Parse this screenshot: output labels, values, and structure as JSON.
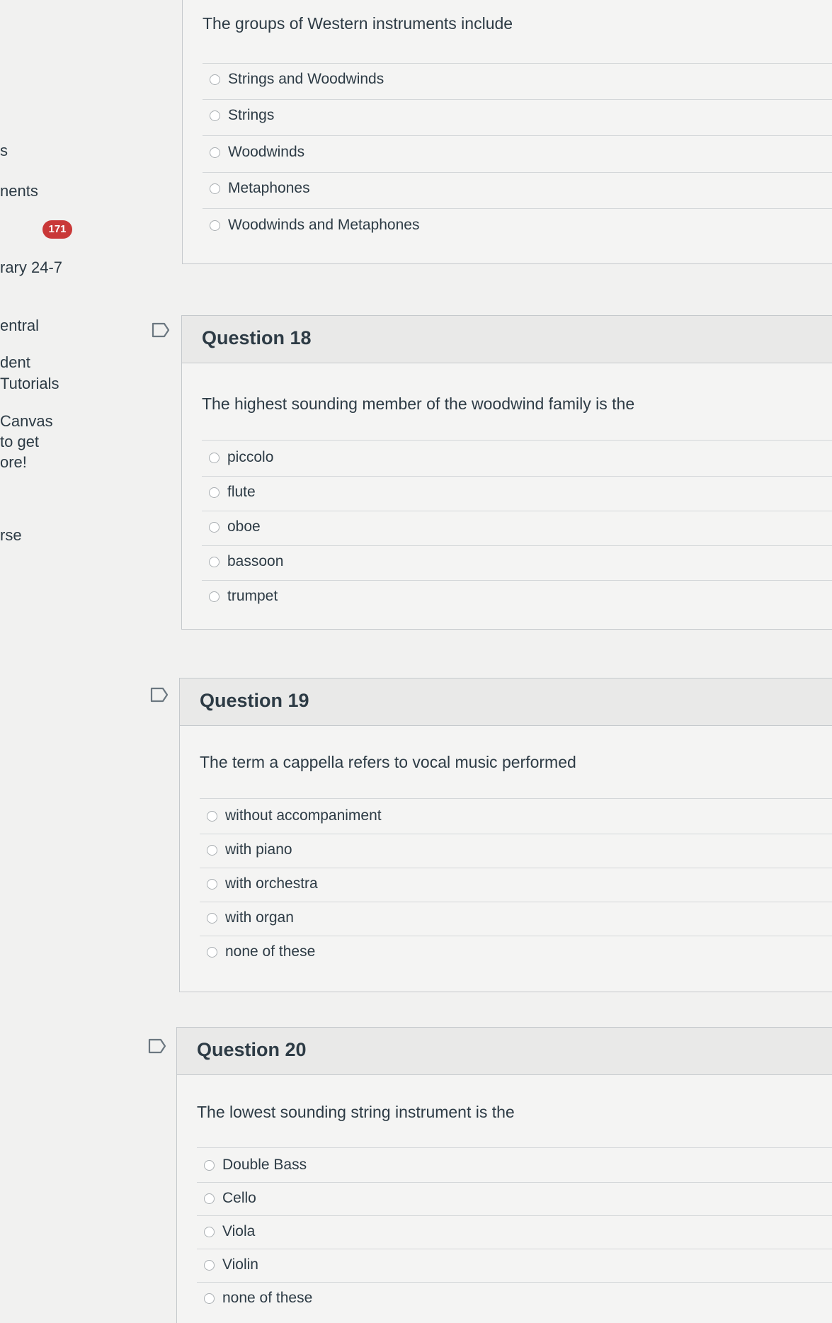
{
  "sidebar": {
    "items": [
      {
        "label": "s"
      },
      {
        "label": "nents"
      },
      {
        "label": "rary 24-7"
      },
      {
        "label": "entral"
      },
      {
        "label": "dent"
      },
      {
        "label": "Tutorials"
      },
      {
        "label": "Canvas"
      },
      {
        "label": "to get"
      },
      {
        "label": "ore!"
      },
      {
        "label": "rse"
      }
    ],
    "badge_count": "171",
    "badge_color": "#c93838"
  },
  "q17": {
    "text": "The groups of Western instruments include",
    "answers": [
      {
        "label": "Strings and Woodwinds"
      },
      {
        "label": "Strings"
      },
      {
        "label": "Woodwinds"
      },
      {
        "label": "Metaphones"
      },
      {
        "label": "Woodwinds and Metaphones"
      }
    ]
  },
  "q18": {
    "title": "Question 18",
    "text": "The highest sounding member of the woodwind family is the",
    "answers": [
      {
        "label": "piccolo"
      },
      {
        "label": "flute"
      },
      {
        "label": "oboe"
      },
      {
        "label": "bassoon"
      },
      {
        "label": "trumpet"
      }
    ]
  },
  "q19": {
    "title": "Question 19",
    "text": "The term a cappella refers to vocal music performed",
    "answers": [
      {
        "label": "without accompaniment"
      },
      {
        "label": "with piano"
      },
      {
        "label": "with orchestra"
      },
      {
        "label": "with organ"
      },
      {
        "label": "none of these"
      }
    ]
  },
  "q20": {
    "title": "Question 20",
    "text": "The lowest sounding string instrument is the",
    "answers": [
      {
        "label": "Double Bass"
      },
      {
        "label": "Cello"
      },
      {
        "label": "Viola"
      },
      {
        "label": "Violin"
      },
      {
        "label": "none of these"
      }
    ]
  },
  "icons": {
    "flag": "flag-icon",
    "radio": "radio-button"
  }
}
